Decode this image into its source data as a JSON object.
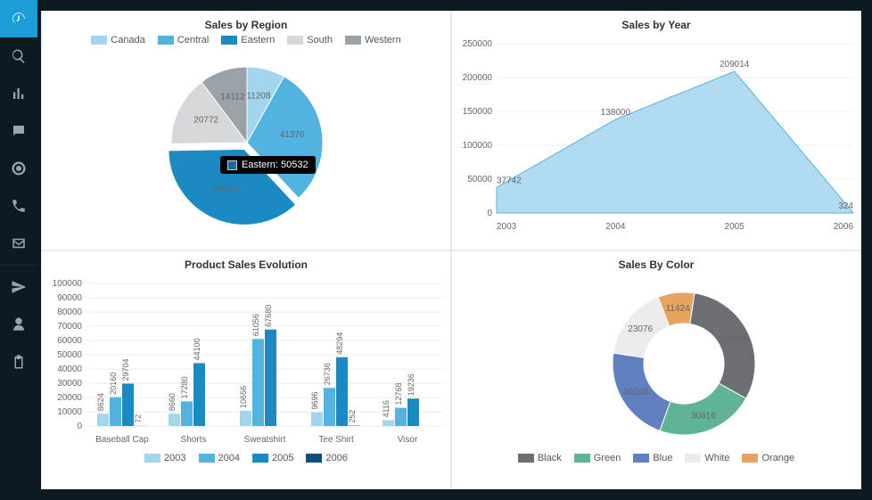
{
  "sidebar": {
    "items": [
      {
        "name": "dashboard-icon",
        "active": true
      },
      {
        "name": "search-icon"
      },
      {
        "name": "bar-chart-icon"
      },
      {
        "name": "comment-icon"
      },
      {
        "name": "target-icon"
      },
      {
        "name": "phone-icon"
      },
      {
        "name": "envelope-icon"
      },
      {
        "separator": true
      },
      {
        "name": "paper-plane-icon"
      },
      {
        "name": "user-icon"
      },
      {
        "name": "clipboard-icon"
      }
    ]
  },
  "colors": {
    "blue1": "#a3d5ee",
    "blue2": "#52b2e0",
    "blue3": "#1c8ac2",
    "blue4": "#0d4f78",
    "grey1": "#d5d8db",
    "grey2": "#9aa1a7",
    "grey3": "#6b6f73",
    "green": "#5fb593",
    "blueAlt": "#5f7fbf",
    "white": "#ececec",
    "orange": "#e5a561"
  },
  "charts": {
    "region": {
      "title": "Sales by Region",
      "legend": [
        "Canada",
        "Central",
        "Eastern",
        "South",
        "Western"
      ],
      "tooltip": "Eastern: 50532"
    },
    "year": {
      "title": "Sales by Year"
    },
    "product": {
      "title": "Product Sales Evolution",
      "legend": [
        "2003",
        "2004",
        "2005",
        "2006"
      ]
    },
    "color": {
      "title": "Sales By Color",
      "legend": [
        "Black",
        "Green",
        "Blue",
        "White",
        "Orange"
      ]
    }
  },
  "chart_data": [
    {
      "type": "pie",
      "id": "sales_by_region",
      "title": "Sales by Region",
      "series": [
        {
          "name": "Canada",
          "value": 11208,
          "color": "#a3d5ee"
        },
        {
          "name": "Central",
          "value": 41376,
          "color": "#52b2e0"
        },
        {
          "name": "Eastern",
          "value": 50532,
          "color": "#1c8ac2"
        },
        {
          "name": "South",
          "value": 20772,
          "color": "#d5d8db"
        },
        {
          "name": "Western",
          "value": 14112,
          "color": "#9aa1a7"
        }
      ],
      "highlight": "Eastern"
    },
    {
      "type": "area",
      "id": "sales_by_year",
      "title": "Sales by Year",
      "x": [
        2003,
        2004,
        2005,
        2006
      ],
      "y": [
        37742,
        138000,
        209014,
        324
      ],
      "ylim": [
        0,
        250000
      ],
      "ytick": 50000,
      "color": "#a3d5ee"
    },
    {
      "type": "bar",
      "id": "product_sales_evolution",
      "title": "Product Sales Evolution",
      "categories": [
        "Baseball Cap",
        "Shorts",
        "Sweatshirt",
        "Tee Shirt",
        "Visor"
      ],
      "series": [
        {
          "name": "2003",
          "color": "#a3d5ee",
          "values": [
            8624,
            8660,
            10656,
            9696,
            4116
          ]
        },
        {
          "name": "2004",
          "color": "#52b2e0",
          "values": [
            20160,
            17280,
            61056,
            26736,
            12768
          ]
        },
        {
          "name": "2005",
          "color": "#1c8ac2",
          "values": [
            29704,
            44100,
            67680,
            48294,
            19236
          ]
        },
        {
          "name": "2006",
          "color": "#0d4f78",
          "values": [
            72,
            0,
            0,
            252,
            0
          ]
        }
      ],
      "ylim": [
        0,
        100000
      ],
      "ytick": 10000
    },
    {
      "type": "pie",
      "id": "sales_by_color",
      "title": "Sales By Color",
      "donut": true,
      "series": [
        {
          "name": "Black",
          "value": 42444,
          "color": "#6b6f73"
        },
        {
          "name": "Green",
          "value": 30816,
          "color": "#5fb593"
        },
        {
          "name": "Blue",
          "value": 30240,
          "color": "#5f7fbf"
        },
        {
          "name": "White",
          "value": 23076,
          "color": "#ececec"
        },
        {
          "name": "Orange",
          "value": 11424,
          "color": "#e5a561"
        }
      ]
    }
  ]
}
